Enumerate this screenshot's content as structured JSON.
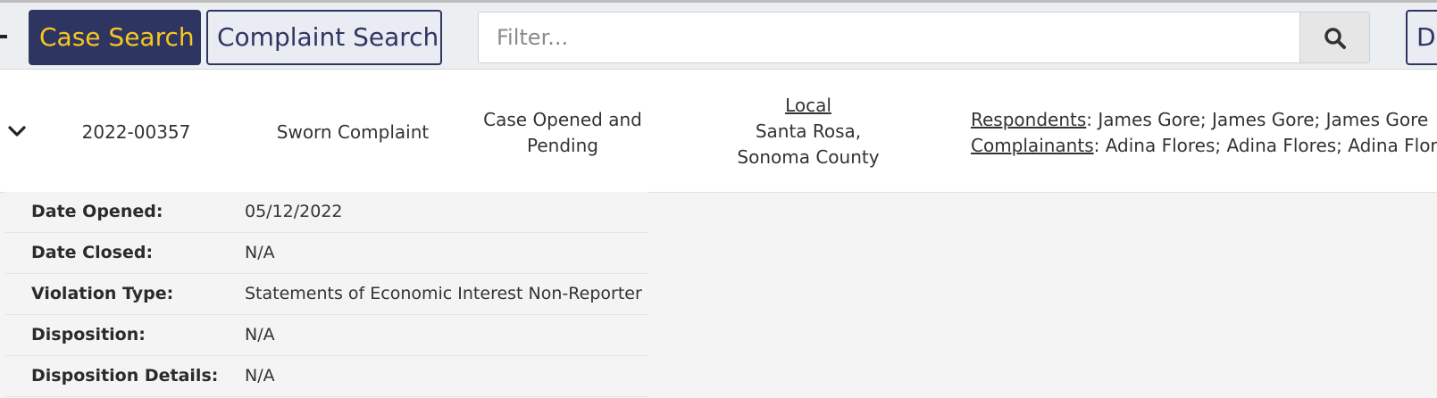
{
  "topbar": {
    "case_search_label": "Case Search",
    "complaint_search_label": "Complaint Search",
    "filter_placeholder": "Filter...",
    "cut_button_label": "D",
    "search_icon": "magnifier-icon"
  },
  "case": {
    "number": "2022-00357",
    "type": "Sworn Complaint",
    "status_line1": "Case Opened and",
    "status_line2": "Pending",
    "jurisdiction_title": "Local",
    "jurisdiction_line1": "Santa Rosa,",
    "jurisdiction_line2": "Sonoma County",
    "respondents_label": "Respondents",
    "respondents_value": ": James Gore; James Gore; James Gore",
    "complainants_label": "Complainants",
    "complainants_value": ": Adina Flores; Adina Flores; Adina Flores",
    "expand_icon": "chevron-down-icon"
  },
  "details": [
    {
      "label": "Date Opened:",
      "value": "05/12/2022"
    },
    {
      "label": "Date Closed:",
      "value": "N/A"
    },
    {
      "label": "Violation Type:",
      "value": "Statements of Economic Interest Non-Reporter"
    },
    {
      "label": "Disposition:",
      "value": "N/A"
    },
    {
      "label": "Disposition Details:",
      "value": "N/A"
    }
  ],
  "colors": {
    "primary_navy": "#2f3561",
    "accent_gold": "#f7c820"
  }
}
